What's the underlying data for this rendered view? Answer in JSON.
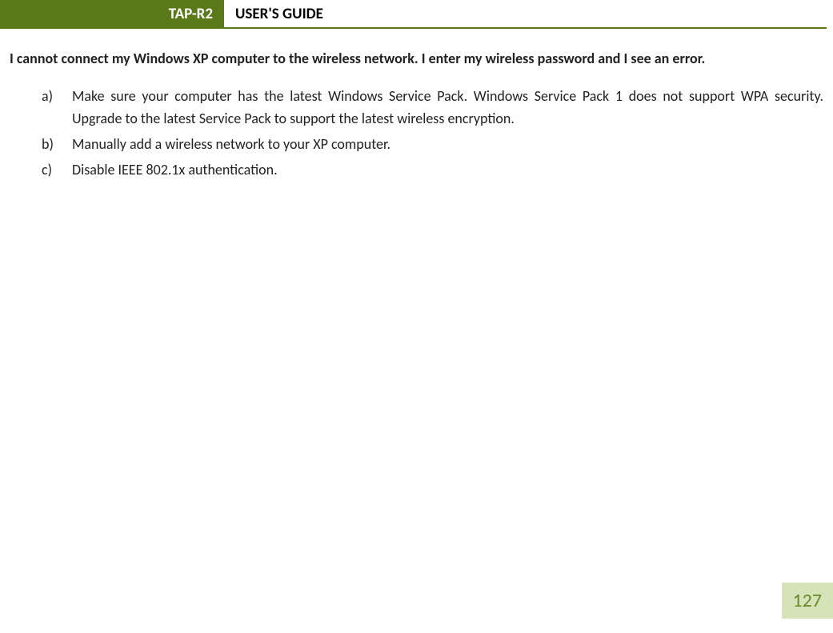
{
  "header": {
    "model": "TAP-R2",
    "title": "USER'S GUIDE"
  },
  "question": "I cannot connect my Windows XP computer to the wireless network.  I enter my wireless password and I see an error.",
  "items": [
    {
      "marker": "a)",
      "text": "Make sure your computer has the latest Windows Service Pack.  Windows Service Pack 1 does not support WPA security.  Upgrade to the latest Service Pack to support the latest wireless encryption."
    },
    {
      "marker": "b)",
      "text": "Manually add a wireless network to your XP computer."
    },
    {
      "marker": "c)",
      "text": "Disable IEEE 802.1x authentication."
    }
  ],
  "page_number": "127"
}
